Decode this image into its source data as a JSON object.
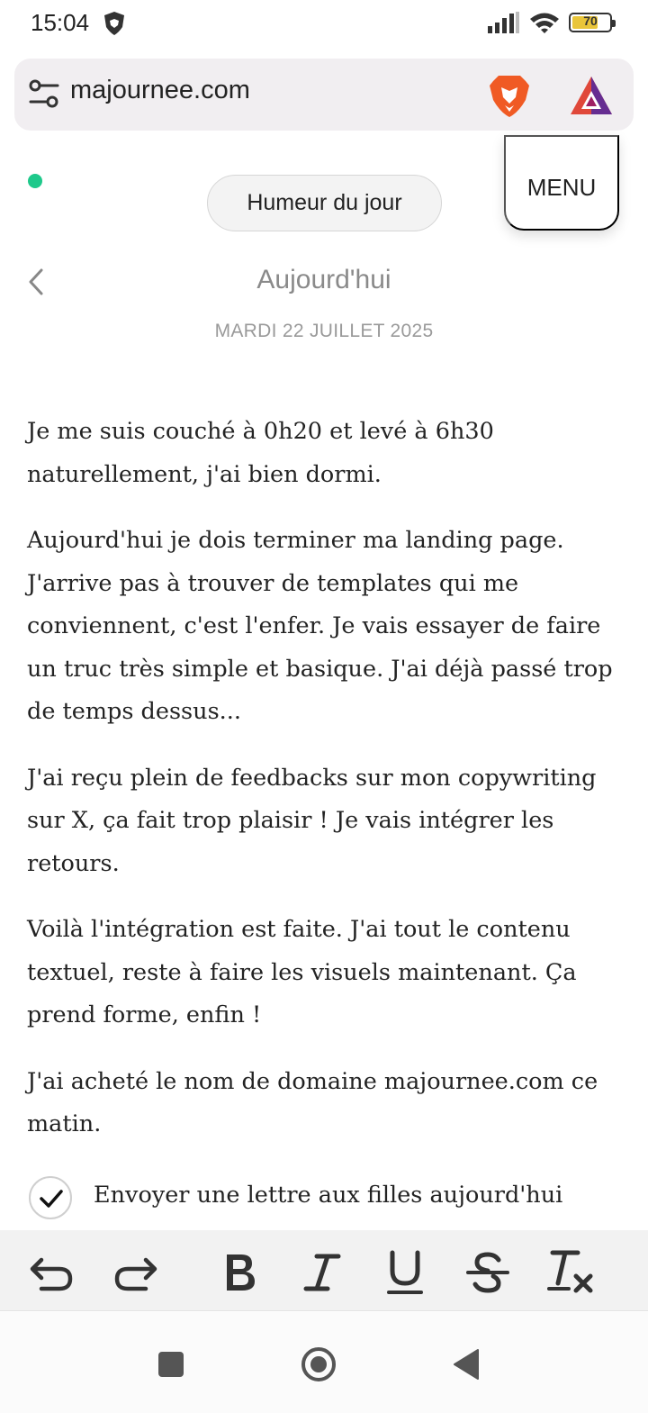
{
  "status_bar": {
    "time": "15:04",
    "battery_level": "70",
    "battery_fraction": 0.7
  },
  "browser": {
    "url": "majournee.com",
    "icons": [
      "site-settings-icon",
      "brave-lion-icon",
      "bat-rewards-icon"
    ]
  },
  "header": {
    "mood_label": "Humeur du jour",
    "menu_label": "MENU",
    "status_color": "#1ec98b"
  },
  "day": {
    "title": "Aujourd'hui",
    "date": "MARDI 22 JUILLET 2025"
  },
  "journal": {
    "paragraphs": [
      "Je me suis couché à 0h20 et levé à 6h30 naturellement, j'ai bien dormi.",
      "Aujourd'hui je dois terminer ma landing page. J'arrive pas à trouver de templates qui me conviennent, c'est l'enfer. Je vais essayer de faire un truc très simple et basique. J'ai déjà passé trop de temps dessus...",
      "J'ai reçu plein de feedbacks sur mon copywriting sur X, ça fait trop plaisir ! Je vais intégrer les retours.",
      "Voilà l'intégration est faite. J'ai tout le contenu textuel, reste à faire les visuels maintenant. Ça prend forme, enfin !",
      "J'ai acheté le nom de domaine majournee.com ce matin."
    ],
    "todo": {
      "label": "Envoyer une lettre aux filles aujourd'hui",
      "checked": true
    }
  },
  "toolbar": {
    "tools": [
      "undo-icon",
      "redo-icon",
      "bold-icon",
      "italic-icon",
      "underline-icon",
      "strikethrough-icon",
      "clear-format-icon"
    ]
  },
  "nav": {
    "buttons": [
      "recents-icon",
      "home-icon",
      "back-nav-icon"
    ]
  }
}
